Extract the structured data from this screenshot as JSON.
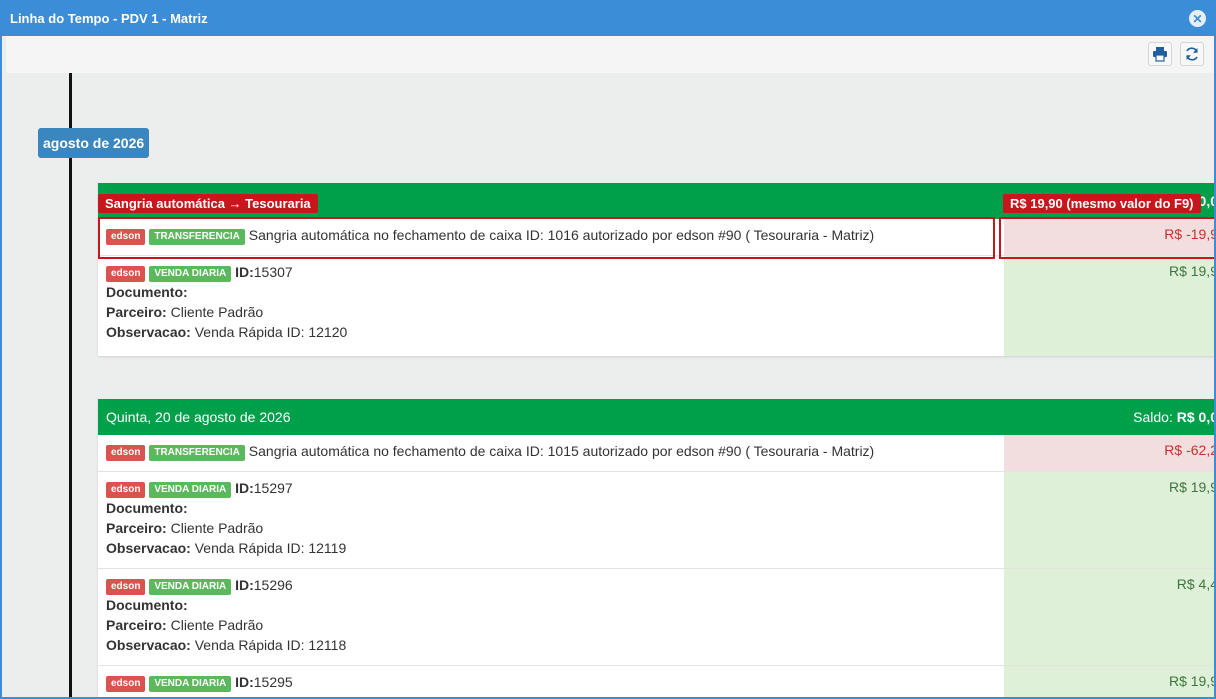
{
  "window": {
    "title": "Linha do Tempo - PDV 1 - Matriz",
    "close_glyph": "✕"
  },
  "toolbar": {
    "icons": [
      "printer-icon",
      "refresh-icon"
    ]
  },
  "timeline": {
    "month_label": "agosto de 2026",
    "cards": [
      {
        "date": "",
        "saldo_label": "",
        "saldo_value": "0,0",
        "rows": [
          {
            "user": "edson",
            "type": "TRANSFERENCIA",
            "text": "Sangria automática no fechamento de caixa ID: 1016 autorizado por edson #90 ( Tesouraria - Matriz)",
            "amount": "R$ -19,9"
          },
          {
            "user": "edson",
            "type": "VENDA DIARIA",
            "id_label": "ID:",
            "id": "15307",
            "documento_label": "Documento:",
            "documento": "",
            "parceiro_label": "Parceiro:",
            "parceiro": "Cliente Padrão",
            "obs_label": "Observacao:",
            "obs": "Venda Rápida ID: 12120",
            "amount": "R$ 19,9"
          }
        ]
      },
      {
        "date": "Quinta, 20 de agosto de 2026",
        "saldo_label": "Saldo:",
        "saldo_value": "R$ 0,0",
        "rows": [
          {
            "user": "edson",
            "type": "TRANSFERENCIA",
            "text": "Sangria automática no fechamento de caixa ID: 1015 autorizado por edson #90 ( Tesouraria - Matriz)",
            "amount": "R$ -62,2"
          },
          {
            "user": "edson",
            "type": "VENDA DIARIA",
            "id_label": "ID:",
            "id": "15297",
            "documento_label": "Documento:",
            "documento": "",
            "parceiro_label": "Parceiro:",
            "parceiro": "Cliente Padrão",
            "obs_label": "Observacao:",
            "obs": "Venda Rápida ID: 12119",
            "amount": "R$ 19,9"
          },
          {
            "user": "edson",
            "type": "VENDA DIARIA",
            "id_label": "ID:",
            "id": "15296",
            "documento_label": "Documento:",
            "documento": "",
            "parceiro_label": "Parceiro:",
            "parceiro": "Cliente Padrão",
            "obs_label": "Observacao:",
            "obs": "Venda Rápida ID: 12118",
            "amount": "R$ 4,4"
          },
          {
            "user": "edson",
            "type": "VENDA DIARIA",
            "id_label": "ID:",
            "id": "15295",
            "amount": "R$ 19,9"
          }
        ]
      }
    ]
  },
  "annotations": {
    "left": "Sangria automática → Tesouraria",
    "right": "R$ 19,90 (mesmo valor do F9)"
  },
  "colors": {
    "accent": "#3a8dd6",
    "header_green": "#00a04a",
    "annotation_red": "#c8161d"
  }
}
